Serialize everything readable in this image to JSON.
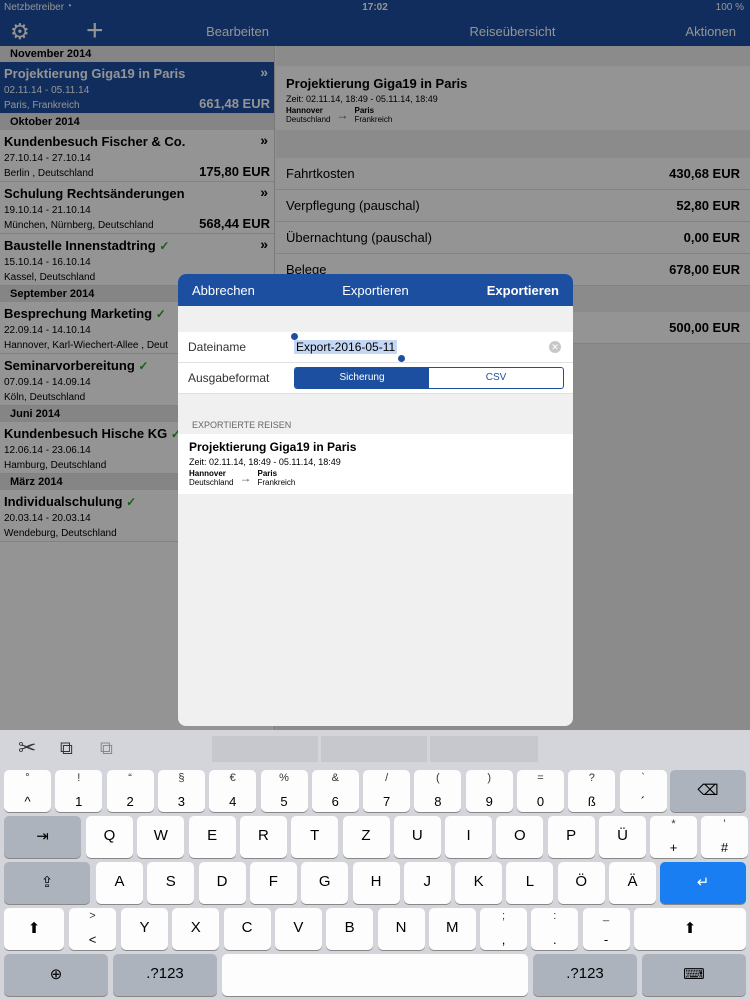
{
  "status": {
    "carrier": "Netzbetreiber",
    "time": "17:02",
    "battery": "100 %"
  },
  "nav": {
    "edit": "Bearbeiten",
    "title": "Reiseübersicht",
    "actions": "Aktionen"
  },
  "list": {
    "sections": [
      {
        "month": "November 2014",
        "trips": [
          {
            "title": "Projektierung Giga19 in Paris",
            "dates": "02.11.14 - 05.11.14",
            "place": "Paris, Frankreich",
            "amount": "661,48 EUR",
            "selected": true
          }
        ]
      },
      {
        "month": "Oktober 2014",
        "trips": [
          {
            "title": "Kundenbesuch Fischer & Co.",
            "dates": "27.10.14 - 27.10.14",
            "place": "Berlin , Deutschland",
            "amount": "175,80 EUR"
          },
          {
            "title": "Schulung Rechtsänderungen",
            "dates": "19.10.14 - 21.10.14",
            "place": "München, Nürnberg, Deutschland",
            "amount": "568,44 EUR"
          },
          {
            "title": "Baustelle Innenstadtring",
            "dates": "15.10.14 - 16.10.14",
            "place": "Kassel, Deutschland",
            "amount": ""
          }
        ]
      },
      {
        "month": "September 2014",
        "trips": [
          {
            "title": "Besprechung Marketing",
            "dates": "22.09.14 - 14.10.14",
            "place": "Hannover, Karl-Wiechert-Allee , Deut",
            "amount": ""
          },
          {
            "title": "Seminarvorbereitung",
            "dates": "07.09.14 - 14.09.14",
            "place": "Köln, Deutschland",
            "amount": ""
          }
        ]
      },
      {
        "month": "Juni 2014",
        "trips": [
          {
            "title": "Kundenbesuch Hische KG",
            "dates": "12.06.14 - 23.06.14",
            "place": "Hamburg, Deutschland",
            "amount": ""
          }
        ]
      },
      {
        "month": "März 2014",
        "trips": [
          {
            "title": "Individualschulung",
            "dates": "20.03.14 - 20.03.14",
            "place": "Wendeburg, Deutschland",
            "amount": ""
          }
        ]
      }
    ]
  },
  "detail": {
    "title": "Projektierung Giga19 in Paris",
    "time": "Zeit: 02.11.14, 18:49 - 05.11.14, 18:49",
    "from_city": "Hannover",
    "from_country": "Deutschland",
    "to_city": "Paris",
    "to_country": "Frankreich",
    "rows": [
      {
        "label": "Fahrtkosten",
        "value": "430,68 EUR"
      },
      {
        "label": "Verpflegung (pauschal)",
        "value": "52,80 EUR"
      },
      {
        "label": "Übernachtung (pauschal)",
        "value": "0,00 EUR"
      },
      {
        "label": "Belege",
        "value": "678,00 EUR"
      },
      {
        "label": "",
        "value": "500,00 EUR"
      }
    ]
  },
  "modal": {
    "cancel": "Abbrechen",
    "title": "Exportieren",
    "confirm": "Exportieren",
    "filename_label": "Dateiname",
    "filename_value": "Export-2016-05-11",
    "format_label": "Ausgabeformat",
    "format_options": [
      "Sicherung",
      "CSV"
    ],
    "format_selected": "Sicherung",
    "section_header": "EXPORTIERTE REISEN",
    "trip": {
      "title": "Projektierung Giga19 in Paris",
      "time": "Zeit: 02.11.14, 18:49 - 05.11.14, 18:49",
      "from_city": "Hannover",
      "from_country": "Deutschland",
      "to_city": "Paris",
      "to_country": "Frankreich"
    }
  },
  "keyboard": {
    "row1": [
      [
        "°",
        "^"
      ],
      [
        "!",
        "1"
      ],
      [
        "“",
        "2"
      ],
      [
        "§",
        "3"
      ],
      [
        "€",
        "4"
      ],
      [
        "%",
        "5"
      ],
      [
        "&",
        "6"
      ],
      [
        "/",
        "7"
      ],
      [
        "(",
        "8"
      ],
      [
        ")",
        "9"
      ],
      [
        "=",
        "0"
      ],
      [
        "?",
        "ß"
      ],
      [
        "`",
        "´"
      ]
    ],
    "row2": [
      "Q",
      "W",
      "E",
      "R",
      "T",
      "Z",
      "U",
      "I",
      "O",
      "P",
      "Ü"
    ],
    "row2_extra": [
      [
        "*",
        "+"
      ],
      [
        "’",
        "#"
      ]
    ],
    "row3": [
      "A",
      "S",
      "D",
      "F",
      "G",
      "H",
      "J",
      "K",
      "L",
      "Ö",
      "Ä"
    ],
    "row4": [
      "Y",
      "X",
      "C",
      "V",
      "B",
      "N",
      "M"
    ],
    "row4_pre": [
      ">",
      "<"
    ],
    "row4_post": [
      [
        ";",
        ","
      ],
      [
        ":",
        "."
      ],
      [
        "_",
        "-"
      ]
    ],
    "mode_label": ".?123"
  }
}
